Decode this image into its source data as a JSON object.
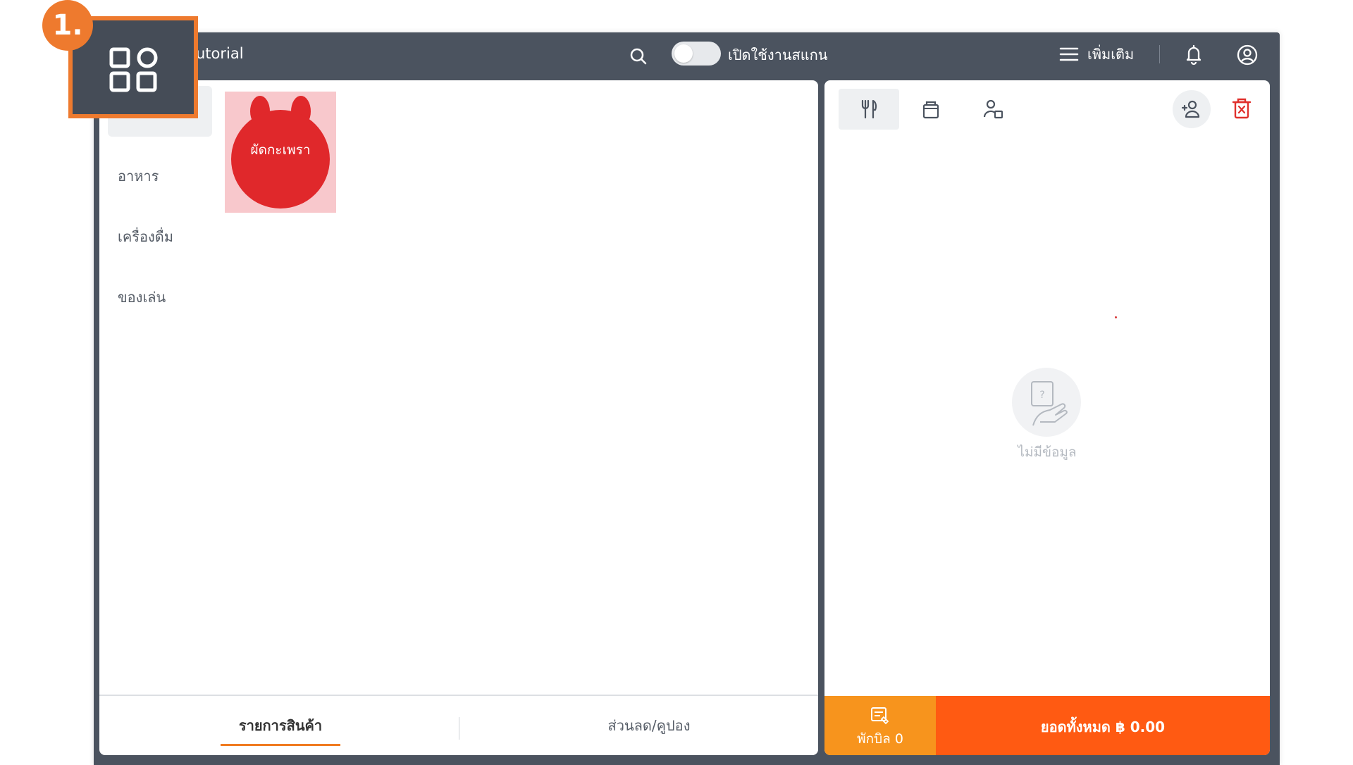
{
  "header": {
    "title": "Tutorial",
    "title_visible": "utorial",
    "scan_toggle_label": "เปิดใช้งานสแกน",
    "more_label": "เพิ่มเติม"
  },
  "categories": [
    {
      "label": ""
    },
    {
      "label": "อาหาร"
    },
    {
      "label": "เครื่องดื่ม"
    },
    {
      "label": "ของเล่น"
    }
  ],
  "products": [
    {
      "label": "ผัดกะเพรา",
      "color": "#e0282b",
      "bg": "#f8c8cc"
    }
  ],
  "left_tabs": {
    "products": "รายการสินค้า",
    "discounts": "ส่วนลด/คูปอง"
  },
  "cart": {
    "empty_text": "ไม่มีข้อมูล",
    "hold_label": "พักบิล 0",
    "total_label": "ยอดทั้งหมด ฿ 0.00"
  },
  "annotation": {
    "step": "1."
  },
  "colors": {
    "topbar": "#4b535f",
    "accent_orange": "#ee7a2e",
    "hold_button": "#f7941d",
    "total_button": "#ff5a12",
    "delete_red": "#e0302c"
  }
}
